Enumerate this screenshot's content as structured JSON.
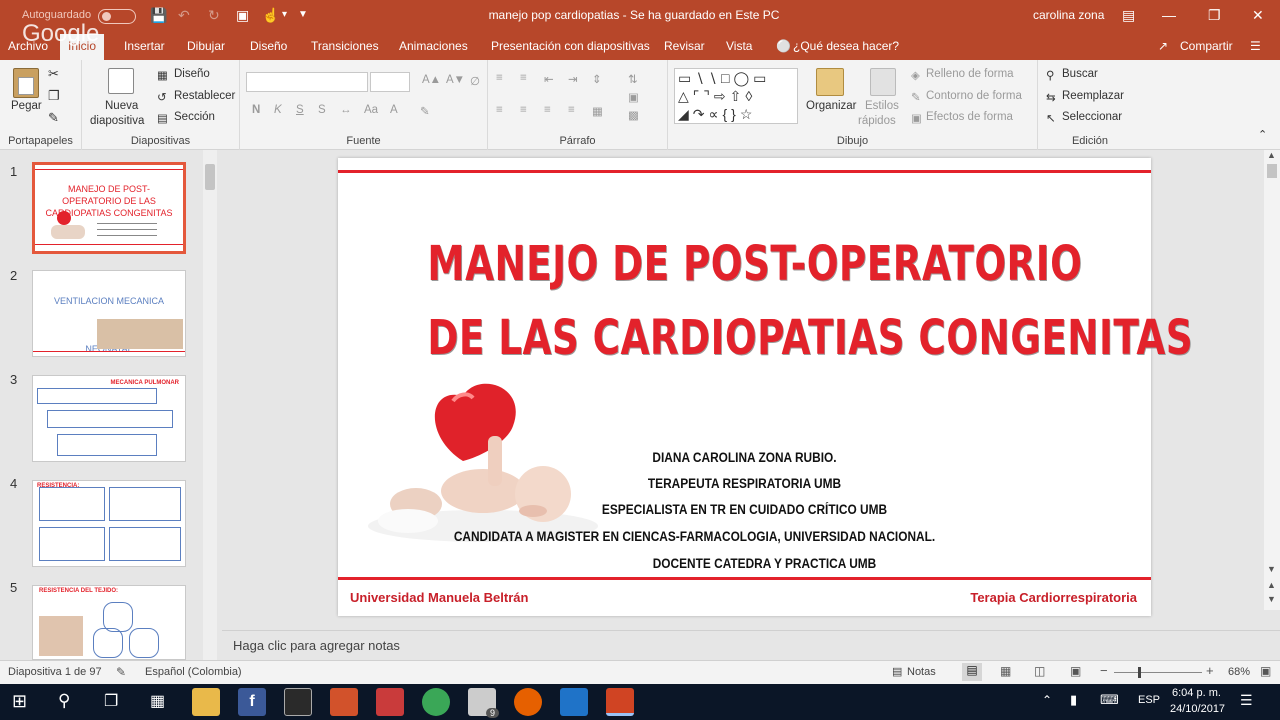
{
  "window": {
    "autosave_label": "Autoguardado",
    "title": "manejo pop cardiopatias  -  Se ha guardado en Este PC",
    "user": "carolina zona"
  },
  "overlay": {
    "google_watermark": "Google"
  },
  "tabs": [
    "Archivo",
    "Inicio",
    "Insertar",
    "Dibujar",
    "Diseño",
    "Transiciones",
    "Animaciones",
    "Presentación con diapositivas",
    "Revisar",
    "Vista"
  ],
  "active_tab": "Inicio",
  "tell_me": "¿Qué desea hacer?",
  "share": "Compartir",
  "ribbon": {
    "portapapeles": {
      "paste": "Pegar",
      "label": "Portapapeles"
    },
    "diapositivas": {
      "new_slide_1": "Nueva",
      "new_slide_2": "diapositiva",
      "layout": "Diseño",
      "reset": "Restablecer",
      "section": "Sección",
      "label": "Diapositivas"
    },
    "fuente": {
      "bold": "N",
      "italic": "K",
      "underline": "S",
      "strike": "S",
      "label": "Fuente"
    },
    "parrafo": {
      "label": "Párrafo"
    },
    "dibujo": {
      "arrange": "Organizar",
      "styles_1": "Estilos",
      "styles_2": "rápidos",
      "fill": "Relleno de forma",
      "outline": "Contorno de forma",
      "effects": "Efectos de forma",
      "label": "Dibujo"
    },
    "edicion": {
      "find": "Buscar",
      "replace": "Reemplazar",
      "select": "Seleccionar",
      "label": "Edición"
    }
  },
  "thumbnails": [
    {
      "num": "1",
      "title": "MANEJO DE POST-OPERATORIO DE LAS CARDIOPATIAS CONGENITAS"
    },
    {
      "num": "2",
      "title": "VENTILACION MECANICA NEONATAL"
    },
    {
      "num": "3",
      "title": "MECANICA PULMONAR"
    },
    {
      "num": "4",
      "title": "RESISTENCIA:"
    },
    {
      "num": "5",
      "title": "RESISTENCIA DEL TEJIDO:"
    }
  ],
  "slide": {
    "title_line1": "MANEJO DE POST-OPERATORIO",
    "title_line2": "DE LAS CARDIOPATIAS CONGENITAS",
    "lines": [
      "DIANA  CAROLINA ZONA RUBIO.",
      "TERAPEUTA RESPIRATORIA UMB",
      "ESPECIALISTA EN TR EN CUIDADO CRÍTICO UMB",
      "CANDIDATA A MAGISTER EN CIENCAS-FARMACOLOGIA, UNIVERSIDAD NACIONAL.",
      "DOCENTE CATEDRA Y PRACTICA  UMB"
    ],
    "footer_left": "Universidad Manuela Beltrán",
    "footer_right": "Terapia Cardiorrespiratoria"
  },
  "notes_placeholder": "Haga clic para agregar notas",
  "status": {
    "slide_counter": "Diapositiva 1 de 97",
    "language": "Español (Colombia)",
    "notes": "Notas",
    "zoom": "68%"
  },
  "taskbar": {
    "lang": "ESP",
    "time": "6:04 p. m.",
    "date": "24/10/2017",
    "mail_badge": "9"
  },
  "colors": {
    "accent": "#b7472a",
    "slide_red": "#e3222b"
  }
}
